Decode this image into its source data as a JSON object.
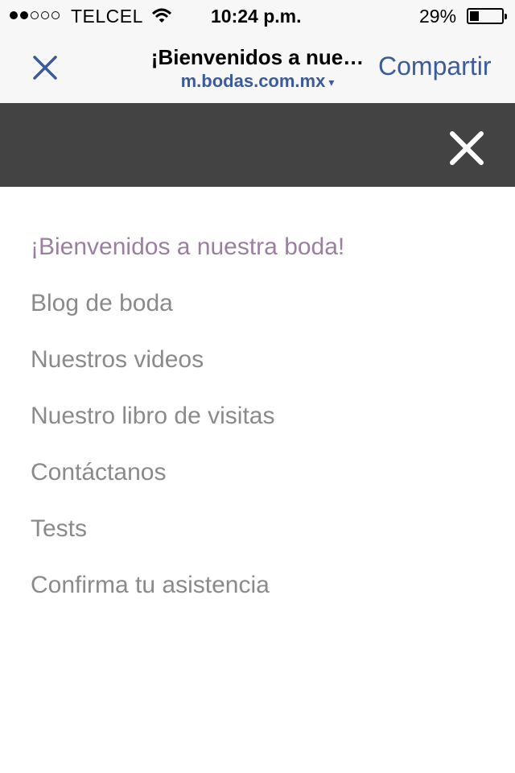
{
  "status_bar": {
    "signal_filled": 2,
    "signal_total": 5,
    "carrier": "TELCEL",
    "time": "10:24 p.m.",
    "battery_percent_label": "29%",
    "battery_level": 0.29
  },
  "browser": {
    "title": "¡Bienvenidos a nue…",
    "domain": "m.bodas.com.mx",
    "domain_caret": "▾",
    "share_label": "Compartir",
    "accent_color": "#3b5b9a"
  },
  "menu": {
    "bar_color": "#434343",
    "active_color": "#9b7fa0",
    "items": [
      {
        "label": "¡Bienvenidos a nuestra boda!",
        "active": true
      },
      {
        "label": "Blog de boda",
        "active": false
      },
      {
        "label": "Nuestros videos",
        "active": false
      },
      {
        "label": "Nuestro libro de visitas",
        "active": false
      },
      {
        "label": "Contáctanos",
        "active": false
      },
      {
        "label": "Tests",
        "active": false
      },
      {
        "label": "Confirma tu asistencia",
        "active": false
      }
    ]
  }
}
